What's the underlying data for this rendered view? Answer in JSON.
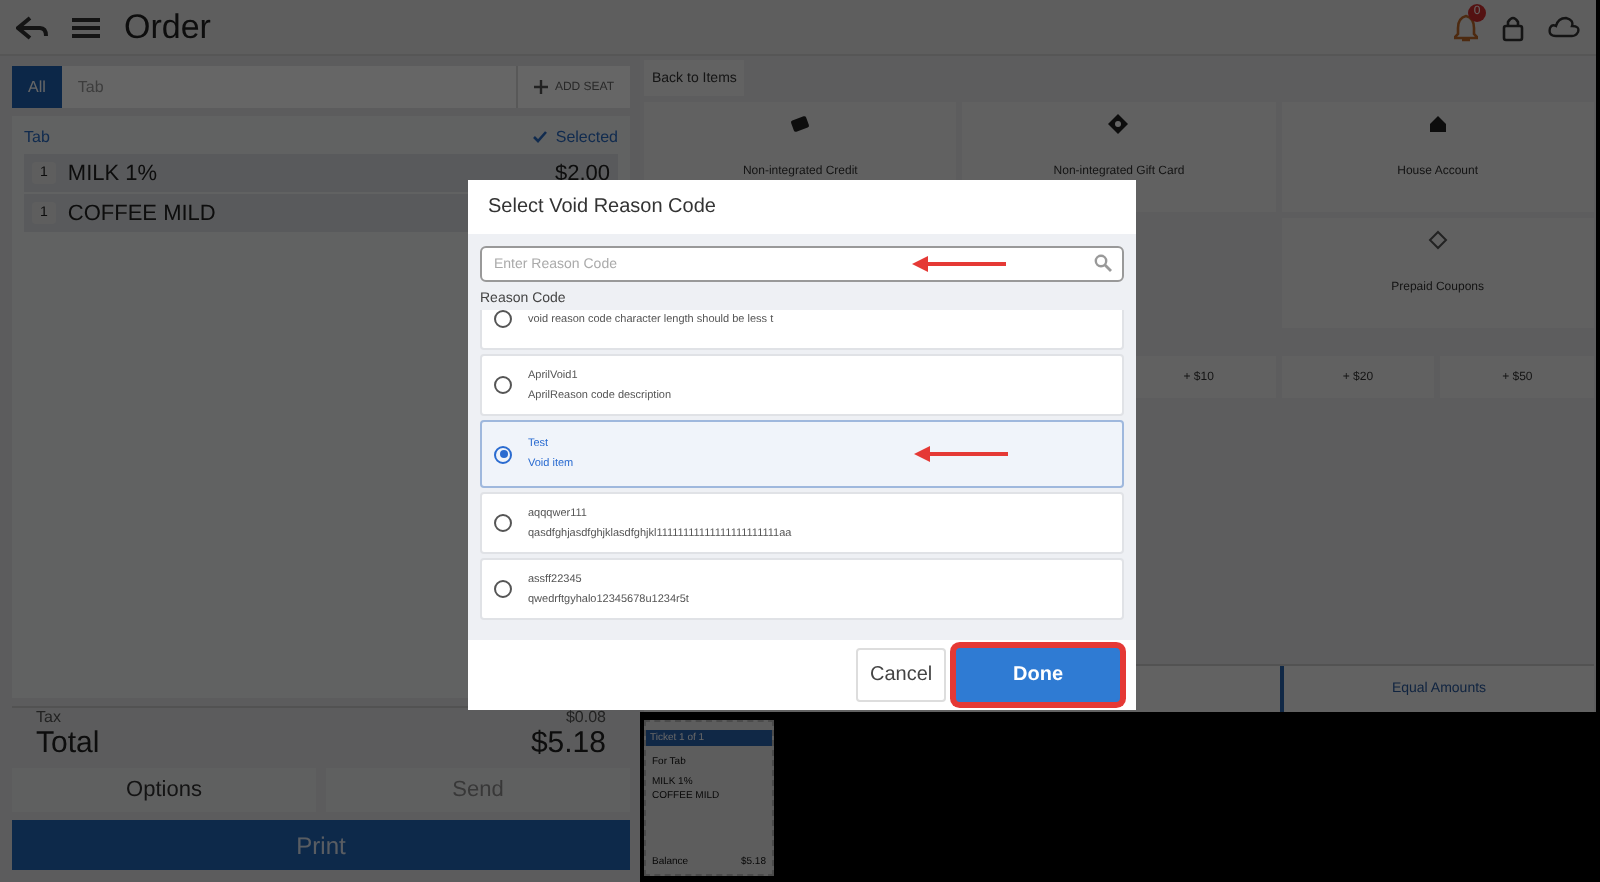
{
  "header": {
    "title": "Order",
    "notification_count": "0"
  },
  "order_panel": {
    "tabs": [
      {
        "label": "All",
        "selected": true
      },
      {
        "label": "Tab",
        "selected": false
      }
    ],
    "add_seat": "ADD SEAT",
    "section": "Tab",
    "section_status": "Selected",
    "items": [
      {
        "qty": "1",
        "name": "MILK 1%",
        "price": "$2.00"
      },
      {
        "qty": "1",
        "name": "COFFEE MILD"
      }
    ],
    "tax_label": "Tax",
    "tax": "$0.08",
    "total_label": "Total",
    "total": "$5.18",
    "buttons": [
      {
        "label": "Options",
        "disabled": false
      },
      {
        "label": "Send",
        "disabled": true
      }
    ],
    "print": "Print"
  },
  "payment_panel": {
    "back": "Back to Items",
    "tiles": [
      {
        "label": "Non-integrated Credit",
        "kind": "credit"
      },
      {
        "label": "Non-integrated Gift Card",
        "kind": "giftcard"
      },
      {
        "label": "House Account",
        "kind": "account"
      },
      {
        "label": "Prepaid Coupons",
        "kind": "coupon"
      }
    ],
    "amounts": [
      "+ $10",
      "+ $20",
      "+ $50"
    ],
    "split_tab": {
      "label": "Equal Amounts",
      "selected": true
    }
  },
  "ticket": {
    "title": "Ticket 1 of 1",
    "for": "For Tab",
    "lines": [
      "MILK 1%",
      "COFFEE MILD"
    ],
    "balance_label": "Balance",
    "balance": "$5.18"
  },
  "dialog": {
    "title": "Select Void Reason Code",
    "search": {
      "placeholder": "Enter Reason Code",
      "annotated": true
    },
    "list_label": "Reason Code",
    "reasons": [
      {
        "description": "void reason code character length should be less t",
        "selected": false
      },
      {
        "name": "AprilVoid1",
        "description": "AprilReason code description",
        "selected": false
      },
      {
        "name": "Test",
        "description": "Void item",
        "selected": true,
        "annotated": true
      },
      {
        "name": "aqqqwer111",
        "description": "qasdfghjasdfghjklasdfghjkl11111111111111111111111aa",
        "selected": false
      },
      {
        "name": "assff22345",
        "description": "qwedrftgyhalo12345678u1234r5t",
        "selected": false
      }
    ],
    "buttons": [
      {
        "label": "Cancel",
        "kind": "secondary",
        "highlighted": false
      },
      {
        "label": "Done",
        "kind": "primary",
        "highlighted": true
      }
    ]
  }
}
